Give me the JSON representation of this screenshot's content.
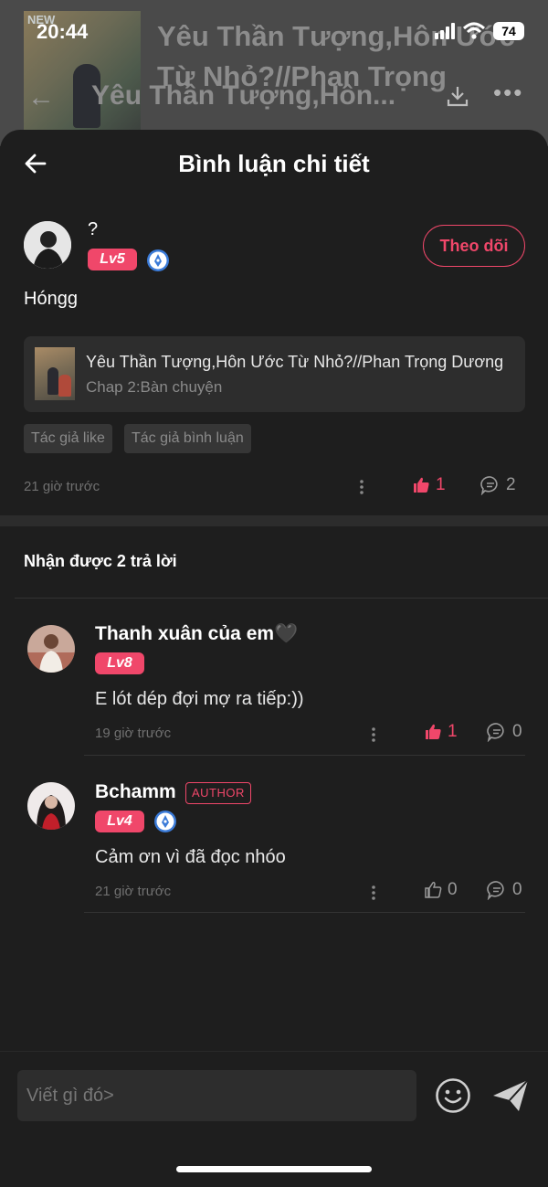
{
  "status_bar": {
    "time": "20:44",
    "battery": "74"
  },
  "background": {
    "new_tag": "NEW",
    "story_title": "Yêu Thần Tượng,Hôn Ước Từ Nhỏ?//Phan Trọng",
    "nav_title": "Yêu Thần Tượng,Hôn..."
  },
  "sheet": {
    "title": "Bình luận chi tiết"
  },
  "main_comment": {
    "user_name": "?",
    "level": "Lv5",
    "follow_label": "Theo dõi",
    "text": "Hóngg",
    "story": {
      "title": "Yêu Thần Tượng,Hôn Ước Từ Nhỏ?//Phan Trọng Dương",
      "chapter": "Chap 2:Bàn chuyện"
    },
    "tags": [
      "Tác giả like",
      "Tác giả bình luận"
    ],
    "time": "21 giờ trước",
    "likes": "1",
    "replies": "2"
  },
  "replies_header": "Nhận được 2 trả lời",
  "replies": [
    {
      "user_name": "Thanh xuân của em🖤",
      "level": "Lv8",
      "text": "E lót dép đợi mợ ra tiếp:))",
      "time": "19 giờ trước",
      "likes": "1",
      "replies": "0",
      "liked": true
    },
    {
      "user_name": "Bchamm",
      "author_badge": "AUTHOR",
      "level": "Lv4",
      "text": "Cảm ơn vì đã đọc nhóo",
      "time": "21 giờ trước",
      "likes": "0",
      "replies": "0",
      "liked": false
    }
  ],
  "input": {
    "placeholder": "Viết gì đó>"
  },
  "colors": {
    "accent": "#f0476a",
    "verify": "#3b7bd8",
    "background": "#1e1e1e"
  }
}
